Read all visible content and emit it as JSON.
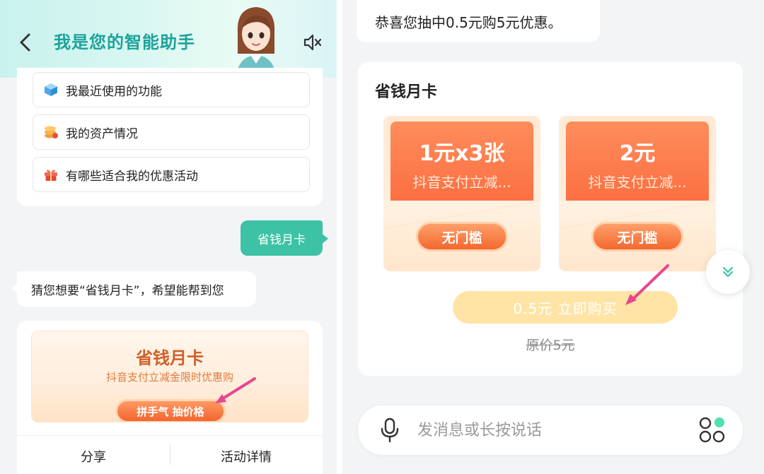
{
  "left": {
    "header": {
      "title": "我是您的智能助手"
    },
    "menu": {
      "items": [
        {
          "label": "我最近使用的功能",
          "icon": "cube-icon"
        },
        {
          "label": "我的资产情况",
          "icon": "coins-icon"
        },
        {
          "label": "有哪些适合我的优惠活动",
          "icon": "gift-icon"
        }
      ]
    },
    "user_message": "省钱月卡",
    "bot_message": "猜您想要“省钱月卡”，希望能帮到您",
    "promo": {
      "title": "省钱月卡",
      "subtitle": "抖音支付立减金限时优惠购",
      "button": "拼手气 抽价格",
      "share": "分享",
      "details": "活动详情"
    }
  },
  "right": {
    "congrats": "恭喜您抽中0.5元购5元优惠。",
    "section_title": "省钱月卡",
    "coupons": [
      {
        "amount": "1元x3张",
        "desc": "抖音支付立减...",
        "badge": "无门槛"
      },
      {
        "amount": "2元",
        "desc": "抖音支付立减...",
        "badge": "无门槛"
      }
    ],
    "buy_button": "0.5元 立即购买",
    "original_price": "原价5元",
    "input_placeholder": "发消息或长按说话"
  },
  "colors": {
    "accent_teal": "#3dc2a6",
    "title_teal": "#1da39b",
    "promo_orange": "#f4652f",
    "arrow_pink": "#e8468f",
    "buy_button": "#ffe4a6"
  }
}
